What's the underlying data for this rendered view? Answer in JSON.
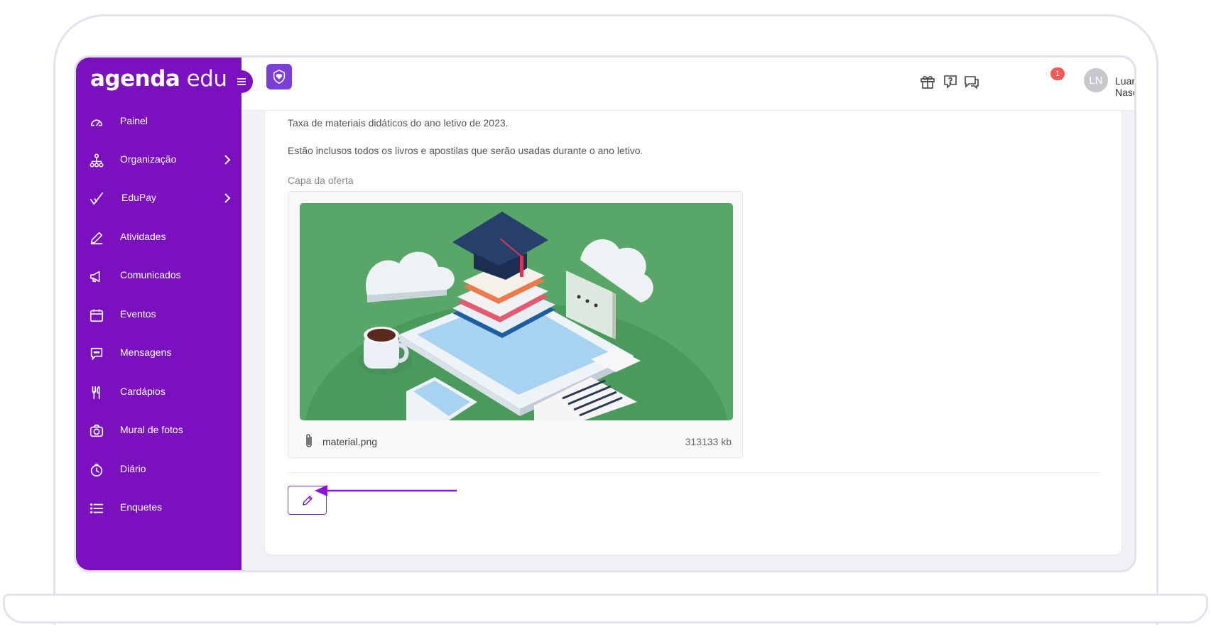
{
  "logo": {
    "brand_bold": "agenda",
    "brand_light": " edu"
  },
  "sidebar": {
    "items": [
      {
        "label": "Painel",
        "icon": "speedometer-icon"
      },
      {
        "label": "Organização",
        "icon": "org-tree-icon",
        "has_submenu": true
      },
      {
        "label": "EduPay",
        "icon": "checkmark-icon",
        "has_submenu": true
      },
      {
        "label": "Atividades",
        "icon": "pencil-icon"
      },
      {
        "label": "Comunicados",
        "icon": "megaphone-icon"
      },
      {
        "label": "Eventos",
        "icon": "calendar-icon"
      },
      {
        "label": "Mensagens",
        "icon": "chat-icon"
      },
      {
        "label": "Cardápios",
        "icon": "cutlery-icon"
      },
      {
        "label": "Mural de fotos",
        "icon": "camera-icon"
      },
      {
        "label": "Diário",
        "icon": "clock-icon"
      },
      {
        "label": "Enquetes",
        "icon": "list-icon"
      }
    ]
  },
  "topbar": {
    "notification_count": "1",
    "user_initials": "LN",
    "user_name": "Luana Nascimento"
  },
  "content": {
    "description_line1": "Taxa de materiais didáticos do ano letivo de 2023.",
    "description_line2": "Estão inclusos todos os livros e apostilas que serão usadas durante o ano letivo.",
    "cover_label": "Capa da oferta",
    "attachment": {
      "file_name": "material.png",
      "file_size": "313133 kb"
    }
  },
  "colors": {
    "brand_purple": "#7b10bf",
    "badge_red": "#f05a55",
    "illustration_green": "#5aa96a"
  }
}
